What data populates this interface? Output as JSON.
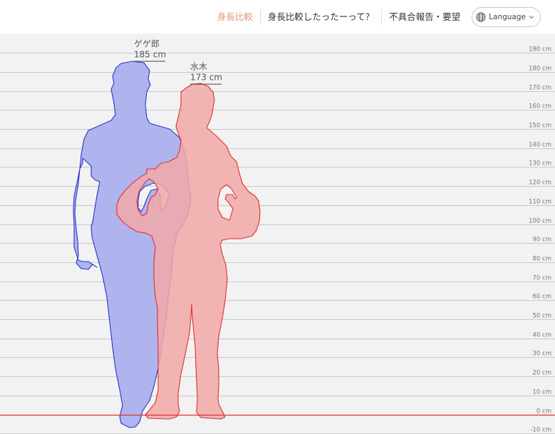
{
  "header": {
    "nav": {
      "compare": "身長比較",
      "how_to": "身長比較したったーって？",
      "report": "不具合報告・要望",
      "language": "Language"
    }
  },
  "chart_data": {
    "type": "height-comparison",
    "unit": "cm",
    "y_ticks": [
      -10,
      0,
      10,
      20,
      30,
      40,
      50,
      60,
      70,
      80,
      90,
      100,
      110,
      120,
      130,
      140,
      150,
      160,
      170,
      180,
      190
    ],
    "y_tick_labels": [
      "-10 cm",
      "0 cm",
      "10 cm",
      "20 cm",
      "30 cm",
      "40 cm",
      "50 cm",
      "60 cm",
      "70 cm",
      "80 cm",
      "90 cm",
      "100 cm",
      "110 cm",
      "120 cm",
      "130 cm",
      "140 cm",
      "150 cm",
      "160 cm",
      "170 cm",
      "180 cm",
      "190 cm"
    ],
    "baseline": 0,
    "persons": [
      {
        "name": "ゲゲ郎",
        "height": 185,
        "height_label": "185 cm",
        "fill": "#a3a9ee",
        "stroke": "#2a34c8"
      },
      {
        "name": "水木",
        "height": 173,
        "height_label": "173 cm",
        "fill": "#f2a8a8",
        "stroke": "#e03030"
      }
    ],
    "baseline_color": "#e03030",
    "grid": true
  }
}
